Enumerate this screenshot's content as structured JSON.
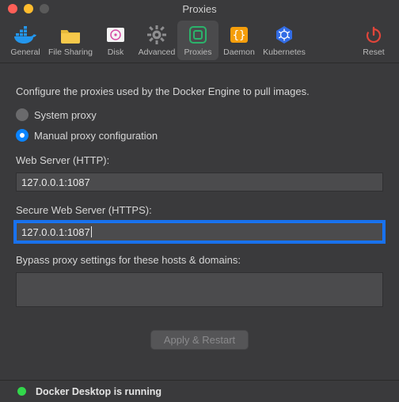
{
  "window": {
    "title": "Proxies"
  },
  "toolbar": {
    "items": [
      {
        "id": "general",
        "label": "General"
      },
      {
        "id": "filesharing",
        "label": "File Sharing"
      },
      {
        "id": "disk",
        "label": "Disk"
      },
      {
        "id": "advanced",
        "label": "Advanced"
      },
      {
        "id": "proxies",
        "label": "Proxies"
      },
      {
        "id": "daemon",
        "label": "Daemon"
      },
      {
        "id": "kubernetes",
        "label": "Kubernetes"
      }
    ],
    "reset_label": "Reset",
    "selected": "proxies"
  },
  "content": {
    "description": "Configure the proxies used by the Docker Engine to pull images.",
    "radio_system_label": "System proxy",
    "radio_manual_label": "Manual proxy configuration",
    "radio_selected": "manual",
    "http_label": "Web Server (HTTP):",
    "http_value": "127.0.0.1:1087",
    "https_label": "Secure Web Server (HTTPS):",
    "https_value": "127.0.0.1:1087",
    "bypass_label": "Bypass proxy settings for these hosts & domains:",
    "bypass_value": "",
    "apply_button": "Apply & Restart"
  },
  "status": {
    "text": "Docker Desktop is running",
    "color": "#32d74b"
  },
  "colors": {
    "accent": "#0a84ff",
    "window_bg": "#3a3a3c"
  }
}
